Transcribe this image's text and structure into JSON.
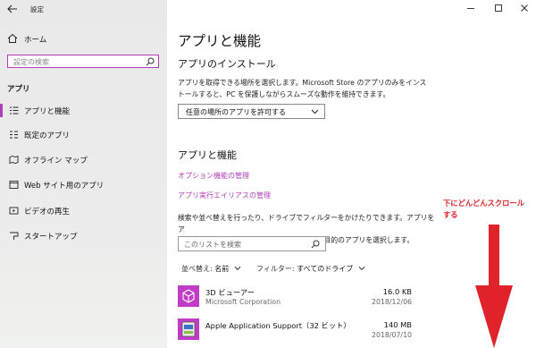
{
  "window": {
    "title": "設定"
  },
  "sidebar": {
    "home_label": "ホーム",
    "search_placeholder": "設定の検索",
    "section_label": "アプリ",
    "items": [
      {
        "label": "アプリと機能",
        "icon": "apps-list-icon",
        "active": true
      },
      {
        "label": "既定のアプリ",
        "icon": "default-apps-icon"
      },
      {
        "label": "オフライン マップ",
        "icon": "map-icon"
      },
      {
        "label": "Web サイト用のアプリ",
        "icon": "web-apps-icon"
      },
      {
        "label": "ビデオの再生",
        "icon": "video-icon"
      },
      {
        "label": "スタートアップ",
        "icon": "startup-icon"
      }
    ]
  },
  "main": {
    "title": "アプリと機能",
    "install": {
      "heading": "アプリのインストール",
      "line1": "アプリを取得できる場所を選択します。Microsoft Store のアプリのみをインス",
      "line2": "トールすると、PC を保護しながらスムーズな動作を維持できます。",
      "dropdown_value": "任意の場所のアプリを許可する"
    },
    "features": {
      "heading": "アプリと機能",
      "link_optional": "オプション機能の管理",
      "link_alias": "アプリ実行エイリアスの管理",
      "line1": "検索や並べ替えを行ったり、ドライブでフィルターをかけたりできます。アプリをア",
      "line2": "ンインストールまたは移動する場合は、一覧で目的のアプリを選択します。",
      "search_placeholder": "このリストを検索",
      "sort_label": "並べ替え:",
      "sort_value": "名前",
      "filter_label": "フィルター:",
      "filter_value": "すべてのドライブ"
    },
    "apps": [
      {
        "name": "3D ビューアー",
        "publisher": "Microsoft Corporation",
        "size": "16.0 KB",
        "date": "2018/12/06"
      },
      {
        "name": "Apple Application Support（32 ビット）",
        "publisher": "",
        "size": "140 MB",
        "date": "2018/07/10"
      }
    ]
  },
  "annotation": {
    "line1": "下にどんどんスクロール",
    "line2": "する",
    "color": "#e0222a"
  },
  "colors": {
    "accent": "#b040b8",
    "sidebar_bg": "#e9e9e9"
  }
}
